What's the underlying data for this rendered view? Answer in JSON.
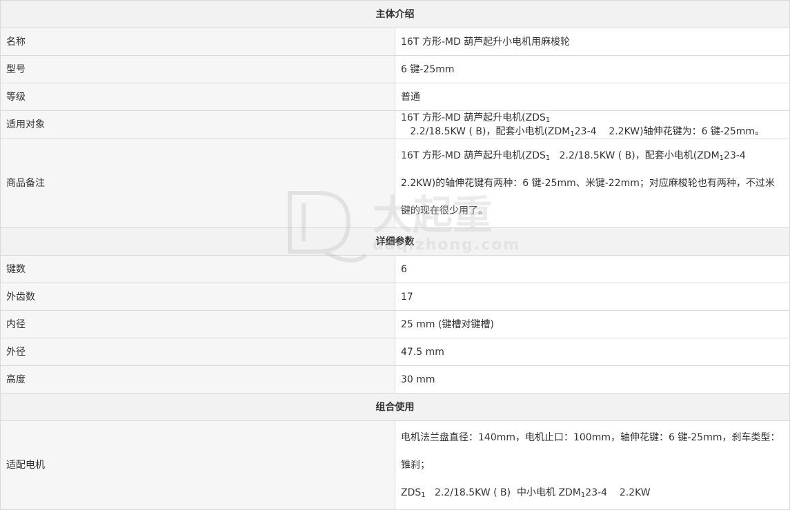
{
  "sections": {
    "intro": "主体介绍",
    "params": "详细参数",
    "combo": "组合使用"
  },
  "rows": {
    "name": {
      "label": "名称",
      "value": "16T 方形-MD 葫芦起升小电机用麻梭轮"
    },
    "model": {
      "label": "型号",
      "value": "6 键-25mm"
    },
    "grade": {
      "label": "等级",
      "value": "普通"
    },
    "applicable": {
      "label": "适用对象",
      "value_a": "16T 方形-MD 葫芦起升电机(ZDS",
      "sub1": "1",
      "value_b": "   2.2/18.5KW ( B)，配套小电机(ZDM",
      "sub2": "1",
      "value_c": "23-4    2.2KW)轴伸花键为：6 键-25mm。"
    },
    "remarks": {
      "label": "商品备注",
      "value_a": "16T 方形-MD 葫芦起升电机(ZDS",
      "sub1": "1",
      "value_b": "   2.2/18.5KW ( B)，配套小电机(ZDM",
      "sub2": "1",
      "value_c": "23-4    2.2KW)的轴伸花键有两种：6 键-25mm、米键-22mm；对应麻梭轮也有两种，不过米键的现在很少用了。"
    },
    "keys": {
      "label": "键数",
      "value": "6"
    },
    "outer_teeth": {
      "label": "外齿数",
      "value": "17"
    },
    "inner_diameter": {
      "label": "内径",
      "value": "25 mm (键槽对键槽)"
    },
    "outer_diameter": {
      "label": "外径",
      "value": "47.5 mm"
    },
    "height": {
      "label": "高度",
      "value": "30 mm"
    },
    "motor": {
      "label": "适配电机",
      "line1": "电机法兰盘直径：140mm，电机止口：100mm，轴伸花键：6 键-25mm，刹车类型：锥刹；",
      "line2_a": "ZDS",
      "sub1": "1",
      "line2_b": "   2.2/18.5KW ( B)  中小电机 ZDM",
      "sub2": "1",
      "line2_c": "23-4    2.2KW"
    }
  },
  "watermark": {
    "brand": "大起重",
    "domain": "daqizhong.com"
  }
}
